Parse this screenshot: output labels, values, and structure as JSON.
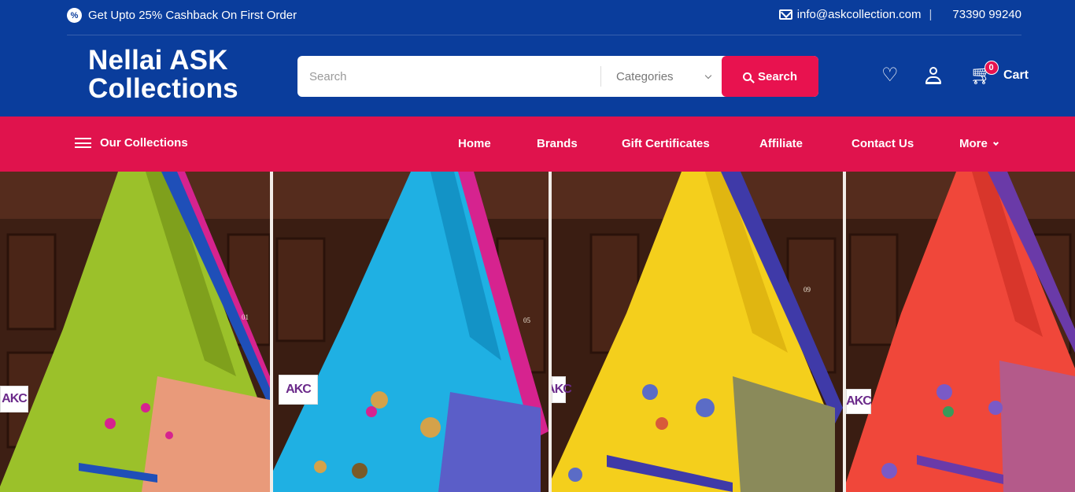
{
  "topbar": {
    "promo_icon": "%",
    "promo_text": "Get Upto 25% Cashback On First Order",
    "email": "info@askcollection.com",
    "separator": "|",
    "phone": "73390 99240"
  },
  "brand": {
    "line1": "Nellai ASK",
    "line2": "Collections"
  },
  "search": {
    "placeholder": "Search",
    "category_label": "Categories",
    "button_label": "Search"
  },
  "header_icons": {
    "wishlist_icon": "heart-icon",
    "account_icon": "user-icon",
    "cart_icon": "cart-icon",
    "cart_count": "0",
    "cart_label": "Cart"
  },
  "nav": {
    "collections_label": "Our Collections",
    "items": [
      {
        "label": "Home"
      },
      {
        "label": "Brands"
      },
      {
        "label": "Gift Certificates"
      },
      {
        "label": "Affiliate"
      },
      {
        "label": "Contact Us"
      },
      {
        "label": "More"
      }
    ]
  },
  "banner": {
    "panels": [
      {
        "code": "01",
        "logo": "AKC"
      },
      {
        "code": "05",
        "logo": "AKC"
      },
      {
        "code": "09",
        "logo": "AKC"
      },
      {
        "code": "",
        "logo": "AKC"
      }
    ]
  },
  "colors": {
    "header_blue": "#0a3d9c",
    "accent_pink": "#e0134d",
    "saree_green": "#9bc12a",
    "saree_blue": "#1fb0e3",
    "saree_yellow": "#f4cf1c",
    "saree_red": "#f0473a"
  }
}
